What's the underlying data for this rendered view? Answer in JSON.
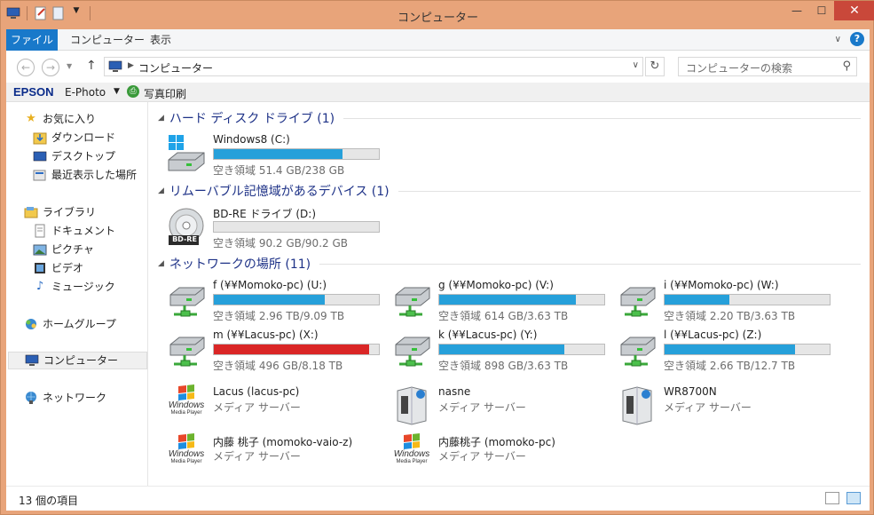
{
  "window": {
    "title": "コンピューター"
  },
  "ribbon": {
    "tabs": [
      "ファイル",
      "コンピューター",
      "表示"
    ]
  },
  "address": {
    "path": "コンピューター",
    "search_placeholder": "コンピューターの検索"
  },
  "epson": {
    "brand": "EPSON",
    "ephoto": "E-Photo",
    "print": "写真印刷"
  },
  "nav": {
    "favorites": "お気に入り",
    "downloads": "ダウンロード",
    "desktop": "デスクトップ",
    "recent": "最近表示した場所",
    "libraries": "ライブラリ",
    "documents": "ドキュメント",
    "pictures": "ピクチャ",
    "videos": "ビデオ",
    "music": "ミュージック",
    "homegroup": "ホームグループ",
    "computer": "コンピューター",
    "network": "ネットワーク"
  },
  "groups": {
    "hdd": "ハード ディスク ドライブ (1)",
    "removable": "リムーバブル記憶域があるデバイス (1)",
    "network": "ネットワークの場所 (11)"
  },
  "drives": {
    "c": {
      "name": "Windows8 (C:)",
      "free": "空き領域 51.4 GB/238 GB",
      "used": 0.78
    },
    "d": {
      "name": "BD-RE ドライブ (D:)",
      "free": "空き領域 90.2 GB/90.2 GB",
      "used": 0.0
    },
    "u": {
      "name": "f (¥¥Momoko-pc) (U:)",
      "free": "空き領域 2.96 TB/9.09 TB",
      "used": 0.67
    },
    "v": {
      "name": "g (¥¥Momoko-pc) (V:)",
      "free": "空き領域 614 GB/3.63 TB",
      "used": 0.83
    },
    "w": {
      "name": "i (¥¥Momoko-pc) (W:)",
      "free": "空き領域 2.20 TB/3.63 TB",
      "used": 0.39
    },
    "x": {
      "name": "m (¥¥Lacus-pc) (X:)",
      "free": "空き領域 496 GB/8.18 TB",
      "used": 0.94
    },
    "y": {
      "name": "k (¥¥Lacus-pc) (Y:)",
      "free": "空き領域 898 GB/3.63 TB",
      "used": 0.76
    },
    "z": {
      "name": "l (¥¥Lacus-pc) (Z:)",
      "free": "空き領域 2.66 TB/12.7 TB",
      "used": 0.79
    }
  },
  "media": {
    "lacus": {
      "name": "Lacus (lacus-pc)",
      "type": "メディア サーバー",
      "logo1": "Windows",
      "logo2": "Media Player"
    },
    "nasne": {
      "name": "nasne",
      "type": "メディア サーバー"
    },
    "wr8700n": {
      "name": "WR8700N",
      "type": "メディア サーバー"
    },
    "vaio": {
      "name": "内藤 桃子 (momoko-vaio-z)",
      "type": "メディア サーバー",
      "logo1": "Windows",
      "logo2": "Media Player"
    },
    "momoko": {
      "name": "内藤桃子 (momoko-pc)",
      "type": "メディア サーバー",
      "logo1": "Windows",
      "logo2": "Media Player"
    }
  },
  "status": {
    "count": "13 個の項目"
  },
  "colors": {
    "accent": "#1979ca",
    "bar_ok": "#26a0da",
    "bar_full": "#da2626",
    "group_title": "#1e3287"
  },
  "bd_label": "BD-RE"
}
